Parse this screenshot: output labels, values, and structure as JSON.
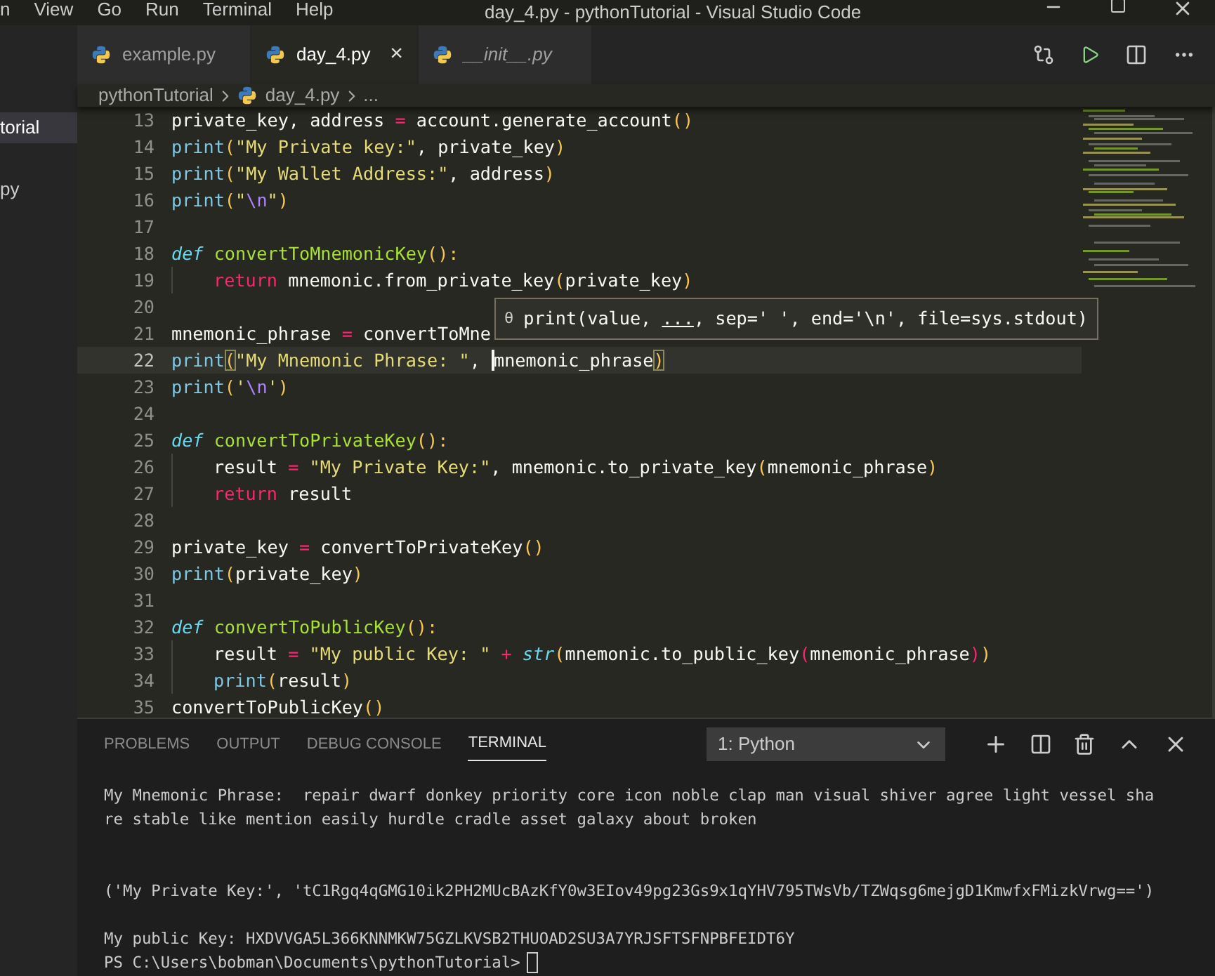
{
  "menu": [
    "n",
    "View",
    "Go",
    "Run",
    "Terminal",
    "Help"
  ],
  "window": {
    "title": "day_4.py - pythonTutorial - Visual Studio Code"
  },
  "sidebar": {
    "items": [
      {
        "label": "torial",
        "selected": true
      },
      {
        "label": "py",
        "selected": false
      }
    ]
  },
  "tabs": [
    {
      "label": "example.py",
      "selected": false,
      "preview": false,
      "closable": false
    },
    {
      "label": "day_4.py",
      "selected": true,
      "preview": false,
      "closable": true
    },
    {
      "label": "__init__.py",
      "selected": false,
      "preview": true,
      "closable": false
    }
  ],
  "tab_close": "×",
  "breadcrumb": [
    "pythonTutorial",
    "day_4.py",
    "..."
  ],
  "editor": {
    "lines": [
      {
        "n": "13",
        "current": false,
        "indent": false,
        "tokens": [
          {
            "text": "private_key, address",
            "kind": "t"
          },
          {
            "text": " = ",
            "kind": "op"
          },
          {
            "text": "account.generate_account",
            "kind": "t"
          },
          {
            "text": "()",
            "kind": "p1"
          }
        ]
      },
      {
        "n": "14",
        "current": false,
        "indent": false,
        "tokens": [
          {
            "text": "print",
            "kind": "bi"
          },
          {
            "text": "(",
            "kind": "p1"
          },
          {
            "text": "\"My Private key:\"",
            "kind": "str"
          },
          {
            "text": ", private_key",
            "kind": "t"
          },
          {
            "text": ")",
            "kind": "p1"
          }
        ]
      },
      {
        "n": "15",
        "current": false,
        "indent": false,
        "tokens": [
          {
            "text": "print",
            "kind": "bi"
          },
          {
            "text": "(",
            "kind": "p1"
          },
          {
            "text": "\"My Wallet Address:\"",
            "kind": "str"
          },
          {
            "text": ", address",
            "kind": "t"
          },
          {
            "text": ")",
            "kind": "p1"
          }
        ]
      },
      {
        "n": "16",
        "current": false,
        "indent": false,
        "tokens": [
          {
            "text": "print",
            "kind": "bi"
          },
          {
            "text": "(",
            "kind": "p1"
          },
          {
            "text": "\"",
            "kind": "str"
          },
          {
            "text": "\\n",
            "kind": "esc"
          },
          {
            "text": "\"",
            "kind": "str"
          },
          {
            "text": ")",
            "kind": "p1"
          }
        ]
      },
      {
        "n": "17",
        "current": false,
        "indent": false
      },
      {
        "n": "18",
        "current": false,
        "indent": false,
        "tokens": [
          {
            "text": "def ",
            "kind": "kw"
          },
          {
            "text": "convertToMnemonicKey",
            "kind": "fn"
          },
          {
            "text": "():",
            "kind": "p1"
          }
        ]
      },
      {
        "n": "19",
        "current": false,
        "indent": true,
        "tokens": [
          {
            "text": "return ",
            "kind": "ctl"
          },
          {
            "text": "mnemonic.from_private_key",
            "kind": "t"
          },
          {
            "text": "(",
            "kind": "p1"
          },
          {
            "text": "private_key",
            "kind": "t"
          },
          {
            "text": ")",
            "kind": "p1"
          }
        ]
      },
      {
        "n": "20",
        "current": false,
        "indent": false
      },
      {
        "n": "21",
        "current": false,
        "indent": false,
        "tokens": [
          {
            "text": "mnemonic_phrase",
            "kind": "t"
          },
          {
            "text": " = ",
            "kind": "op"
          },
          {
            "text": "convertToMne",
            "kind": "t"
          }
        ]
      },
      {
        "n": "22",
        "current": true,
        "indent": false,
        "tokens": [
          {
            "text": "print",
            "kind": "bi"
          },
          {
            "text": "(",
            "kind": "pm"
          },
          {
            "text": "\"My Mnemonic Phrase: \"",
            "kind": "str"
          },
          {
            "text": ", ",
            "kind": "t"
          },
          {
            "text": "mnemonic_phrase",
            "kind": "cur"
          },
          {
            "text": ")",
            "kind": "pm"
          }
        ]
      },
      {
        "n": "23",
        "current": false,
        "indent": false,
        "tokens": [
          {
            "text": "print",
            "kind": "bi"
          },
          {
            "text": "(",
            "kind": "p1"
          },
          {
            "text": "'",
            "kind": "str"
          },
          {
            "text": "\\n",
            "kind": "esc"
          },
          {
            "text": "'",
            "kind": "str"
          },
          {
            "text": ")",
            "kind": "p1"
          }
        ]
      },
      {
        "n": "24",
        "current": false,
        "indent": false
      },
      {
        "n": "25",
        "current": false,
        "indent": false,
        "tokens": [
          {
            "text": "def ",
            "kind": "kw"
          },
          {
            "text": "convertToPrivateKey",
            "kind": "fn"
          },
          {
            "text": "():",
            "kind": "p1"
          }
        ]
      },
      {
        "n": "26",
        "current": false,
        "indent": true,
        "tokens": [
          {
            "text": "result",
            "kind": "t"
          },
          {
            "text": " = ",
            "kind": "op"
          },
          {
            "text": "\"My Private Key:\"",
            "kind": "str"
          },
          {
            "text": ", mnemonic.to_private_key",
            "kind": "t"
          },
          {
            "text": "(",
            "kind": "p1"
          },
          {
            "text": "mnemonic_phrase",
            "kind": "t"
          },
          {
            "text": ")",
            "kind": "p1"
          }
        ]
      },
      {
        "n": "27",
        "current": false,
        "indent": true,
        "tokens": [
          {
            "text": "return ",
            "kind": "ctl"
          },
          {
            "text": "result",
            "kind": "t"
          }
        ]
      },
      {
        "n": "28",
        "current": false,
        "indent": false
      },
      {
        "n": "29",
        "current": false,
        "indent": false,
        "tokens": [
          {
            "text": "private_key",
            "kind": "t"
          },
          {
            "text": " = ",
            "kind": "op"
          },
          {
            "text": "convertToPrivateKey",
            "kind": "t"
          },
          {
            "text": "()",
            "kind": "p1"
          }
        ]
      },
      {
        "n": "30",
        "current": false,
        "indent": false,
        "tokens": [
          {
            "text": "print",
            "kind": "bi"
          },
          {
            "text": "(",
            "kind": "p1"
          },
          {
            "text": "private_key",
            "kind": "t"
          },
          {
            "text": ")",
            "kind": "p1"
          }
        ]
      },
      {
        "n": "31",
        "current": false,
        "indent": false
      },
      {
        "n": "32",
        "current": false,
        "indent": false,
        "tokens": [
          {
            "text": "def ",
            "kind": "kw"
          },
          {
            "text": "convertToPublicKey",
            "kind": "fn"
          },
          {
            "text": "():",
            "kind": "p1"
          }
        ]
      },
      {
        "n": "33",
        "current": false,
        "indent": true,
        "tokens": [
          {
            "text": "result",
            "kind": "t"
          },
          {
            "text": " = ",
            "kind": "op"
          },
          {
            "text": "\"My public Key: \"",
            "kind": "str"
          },
          {
            "text": " + ",
            "kind": "op"
          },
          {
            "text": "str",
            "kind": "bii"
          },
          {
            "text": "(",
            "kind": "p1"
          },
          {
            "text": "mnemonic.to_public_key",
            "kind": "t"
          },
          {
            "text": "(",
            "kind": "p2"
          },
          {
            "text": "mnemonic_phrase",
            "kind": "t"
          },
          {
            "text": ")",
            "kind": "p2"
          },
          {
            "text": ")",
            "kind": "p1"
          }
        ]
      },
      {
        "n": "34",
        "current": false,
        "indent": true,
        "tokens": [
          {
            "text": "print",
            "kind": "bi"
          },
          {
            "text": "(",
            "kind": "p1"
          },
          {
            "text": "result",
            "kind": "t"
          },
          {
            "text": ")",
            "kind": "p1"
          }
        ]
      },
      {
        "n": "35",
        "current": false,
        "indent": false,
        "tokens": [
          {
            "text": "convertToPublicKey",
            "kind": "t"
          },
          {
            "text": "()",
            "kind": "p1"
          }
        ]
      }
    ]
  },
  "hover": {
    "icon": "θ",
    "parts": [
      {
        "t": "print(value, ",
        "underline": false
      },
      {
        "t": "...",
        "underline": true
      },
      {
        "t": ", sep=' ', end='\\n', file=sys.stdout)",
        "underline": false
      }
    ]
  },
  "panel": {
    "tabs": [
      {
        "label": "PROBLEMS",
        "selected": false
      },
      {
        "label": "OUTPUT",
        "selected": false
      },
      {
        "label": "DEBUG CONSOLE",
        "selected": false
      },
      {
        "label": "TERMINAL",
        "selected": true
      }
    ],
    "terminal_select": "1: Python",
    "terminal_lines": [
      {
        "text": "My Mnemonic Phrase:  repair dwarf donkey priority core icon noble clap man visual shiver agree light vessel sha",
        "kind": "line"
      },
      {
        "text": "re stable like mention easily hurdle cradle asset galaxy about broken",
        "kind": "line"
      },
      {
        "text": "('My Private Key:', 'tC1Rgq4qGMG10ik2PH2MUcBAzKfY0w3EIov49pg23Gs9x1qYHV795TWsVb/TZWqsg6mejgD1KmwfxFMizkVrwg==')",
        "kind": "gap2"
      },
      {
        "text": "My public Key: HXDVVGA5L366KNNMKW75GZLKVSB2THUOAD2SU3A7YRJSFTSFNPBFEIDT6Y",
        "kind": "gap1"
      }
    ],
    "prompt": "PS C:\\Users\\bobman\\Documents\\pythonTutorial>"
  }
}
